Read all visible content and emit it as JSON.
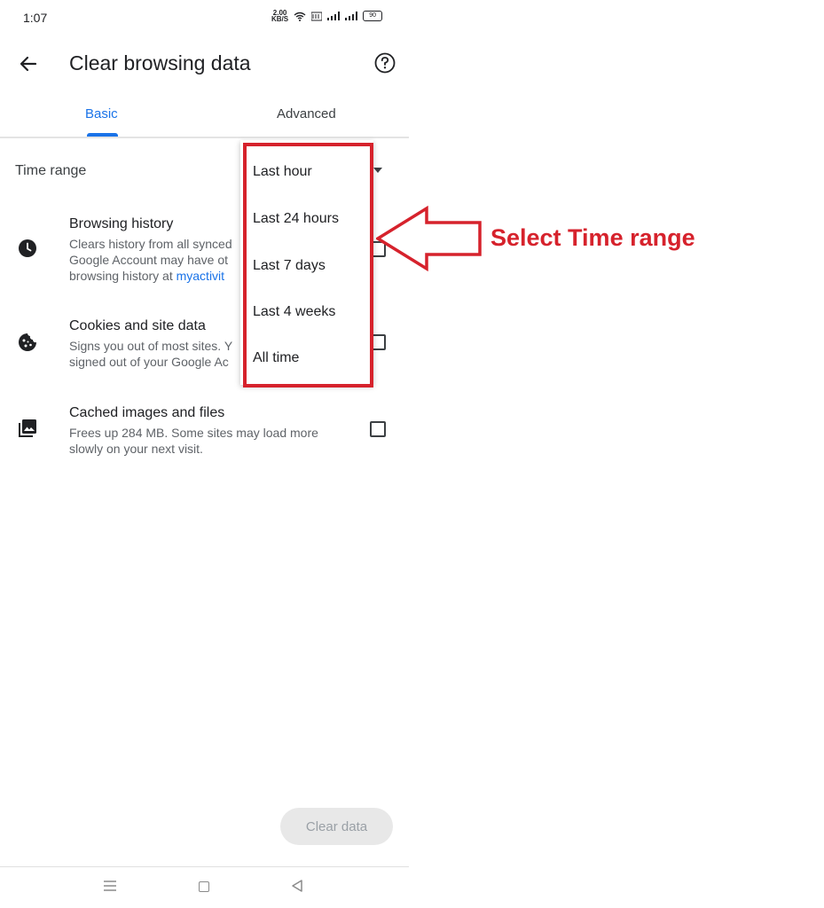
{
  "status_bar": {
    "time": "1:07",
    "net_speed_top": "2.00",
    "net_speed_bottom": "KB/S",
    "battery": "90"
  },
  "header": {
    "title": "Clear browsing data"
  },
  "tabs": [
    {
      "label": "Basic",
      "selected": true
    },
    {
      "label": "Advanced",
      "selected": false
    }
  ],
  "time_range": {
    "label": "Time range"
  },
  "items": [
    {
      "title": "Browsing history",
      "desc_lines": [
        "Clears history from all synced",
        "Google Account may have ot",
        "browsing history at "
      ],
      "link": "myactivit",
      "icon": "clock-icon"
    },
    {
      "title": "Cookies and site data",
      "desc_lines": [
        "Signs you out of most sites. Y",
        "signed out of your Google Ac"
      ],
      "icon": "cookie-icon"
    },
    {
      "title": "Cached images and files",
      "desc": "Frees up 284 MB. Some sites may load more slowly on your next visit.",
      "icon": "image-icon"
    }
  ],
  "dropdown_options": [
    "Last hour",
    "Last 24 hours",
    "Last 7 days",
    "Last 4 weeks",
    "All time"
  ],
  "annotation": {
    "text": "Select Time range",
    "color": "#d6222c"
  },
  "footer": {
    "clear_button": "Clear data"
  },
  "colors": {
    "accent": "#1a73e8",
    "annotation_red": "#d6222c"
  }
}
